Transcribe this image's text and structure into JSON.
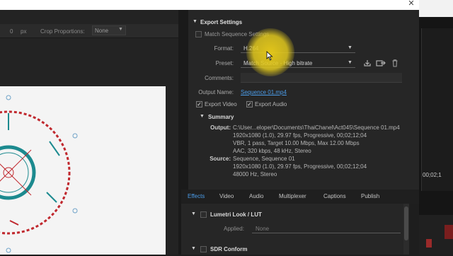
{
  "left_toolbar": {
    "zero": "0",
    "px": "px",
    "crop_label": "Crop Proportions:",
    "crop_value": "None"
  },
  "export_settings": {
    "header": "Export Settings",
    "match_sequence": "Match Sequence Settings",
    "format_label": "Format:",
    "format_value": "H.264",
    "preset_label": "Preset:",
    "preset_value": "Match Source - High bitrate",
    "comments_label": "Comments:",
    "output_name_label": "Output Name:",
    "output_name_value": "Sequence 01.mp4",
    "export_video": "Export Video",
    "export_audio": "Export Audio",
    "summary_label": "Summary",
    "output_key": "Output:",
    "output_lines": [
      "C:\\User...eloper\\Documents\\ThaiChanel\\Act045\\Sequence 01.mp4",
      "1920x1080 (1.0), 29.97 fps, Progressive, 00;02;12;04",
      "VBR, 1 pass, Target 10.00 Mbps, Max 12.00 Mbps",
      "AAC, 320 kbps, 48 kHz, Stereo"
    ],
    "source_key": "Source:",
    "source_lines": [
      "Sequence, Sequence 01",
      "1920x1080 (1.0), 29.97 fps, Progressive, 00;02;12;04",
      "48000 Hz, Stereo"
    ]
  },
  "tabs": [
    "Effects",
    "Video",
    "Audio",
    "Multiplexer",
    "Captions",
    "Publish"
  ],
  "effects": {
    "lumetri_label": "Lumetri Look / LUT",
    "applied_label": "Applied:",
    "applied_value": "None",
    "sdr_label": "SDR Conform"
  },
  "right_strip": {
    "timecode": "00;02;1"
  },
  "colors": {
    "accent_blue": "#4b9ce8",
    "highlight": "#e8cc1e",
    "graphic_teal": "#1c8a8f",
    "graphic_red": "#c0282e"
  }
}
